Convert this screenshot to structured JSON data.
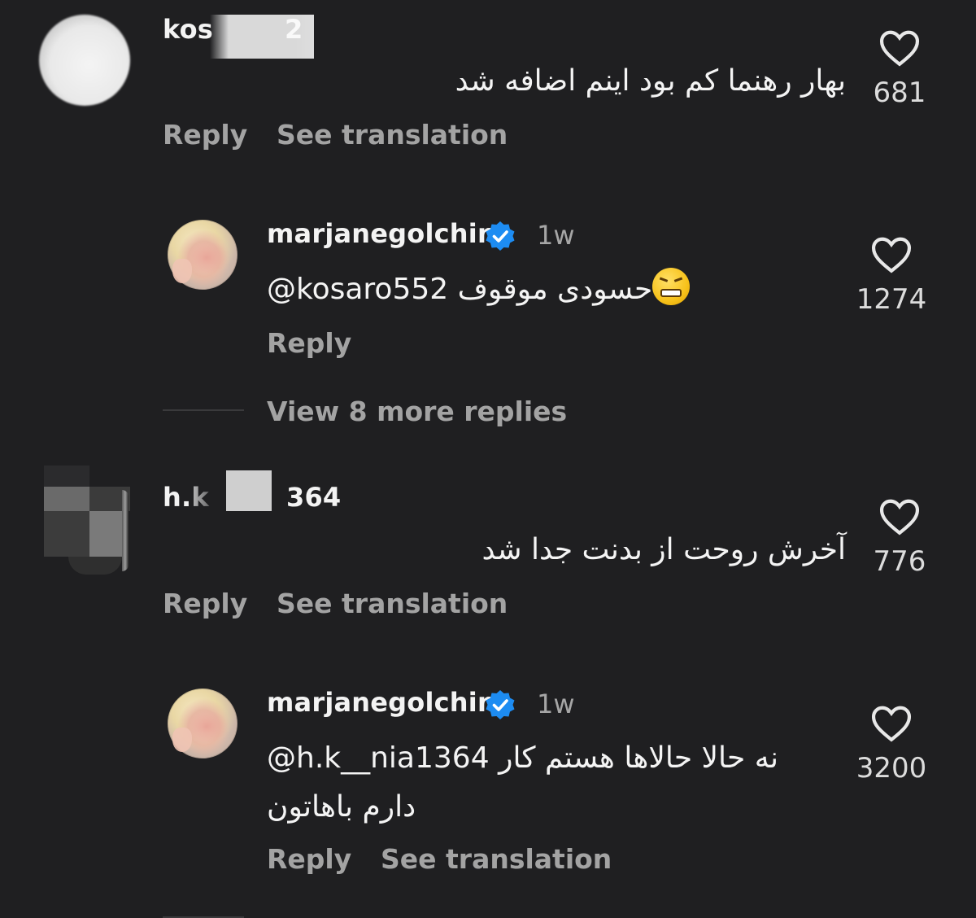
{
  "colors": {
    "background": "#1f1f21",
    "verified_badge": "#1d8cf2",
    "text_primary": "#f3f3f3",
    "text_secondary": "#a6a6a6"
  },
  "comments": [
    {
      "username_visible_start": "kos",
      "username_visible_end": "2",
      "text": "بهار رهنما کم بود اینم اضافه شد",
      "likes": "681",
      "actions": {
        "reply": "Reply",
        "see_translation": "See translation"
      },
      "replies": [
        {
          "username": "marjanegolchin",
          "verified": true,
          "time": "1w",
          "mention": "@kosaro552",
          "text": "حسودی موقوف",
          "emoji": "confounded-grin-emoji",
          "likes": "1274",
          "actions": {
            "reply": "Reply"
          }
        }
      ],
      "view_more": "View 8 more replies"
    },
    {
      "username_visible_start": "h.k",
      "username_visible_end": "364",
      "text": "آخرش روحت از بدنت جدا شد",
      "likes": "776",
      "actions": {
        "reply": "Reply",
        "see_translation": "See translation"
      },
      "replies": [
        {
          "username": "marjanegolchin",
          "verified": true,
          "time": "1w",
          "mention": "@h.k__nia1364",
          "text_line1": "نه حالا حالاها هستم کار",
          "text_line2": "دارم باهاتون",
          "likes": "3200",
          "actions": {
            "reply": "Reply",
            "see_translation": "See translation"
          }
        }
      ]
    }
  ],
  "icons": {
    "like": "heart-outline-icon",
    "verified": "verified-badge-icon"
  }
}
